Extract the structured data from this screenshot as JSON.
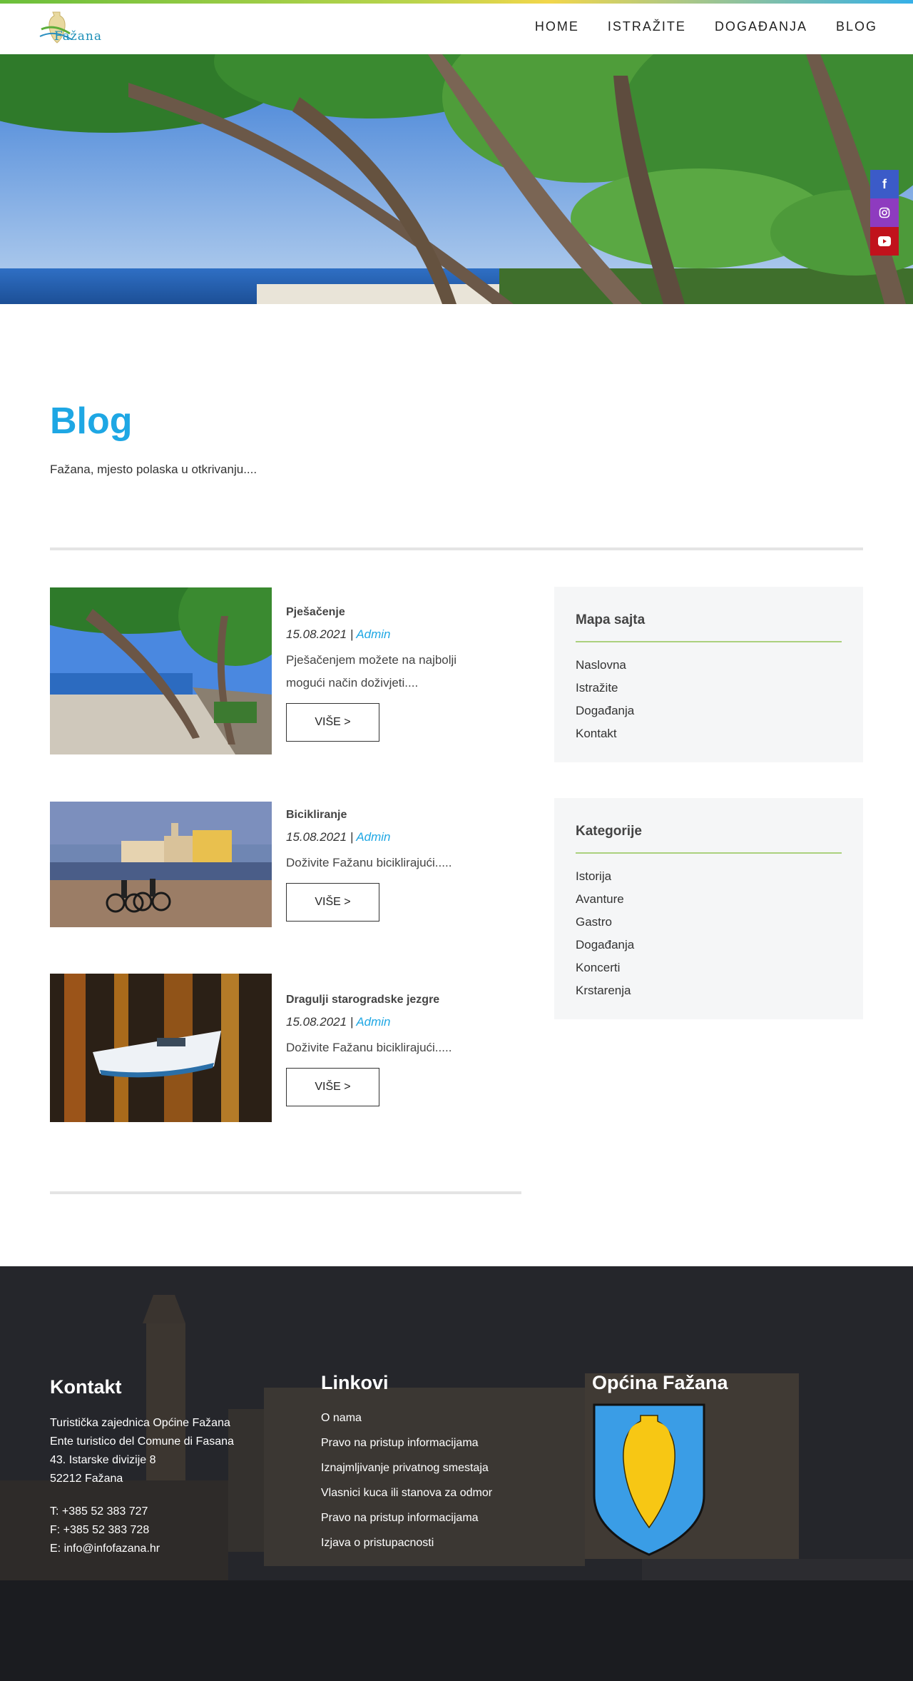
{
  "header": {
    "logo_text": "Fažana",
    "nav": [
      "HOME",
      "ISTRAŽITE",
      "DOGAĐANJA",
      "BLOG"
    ]
  },
  "social": [
    "facebook-icon",
    "instagram-icon",
    "youtube-icon"
  ],
  "main": {
    "title": "Blog",
    "subtitle": "Fažana, mjesto polaska u otkrivanju...."
  },
  "posts": [
    {
      "title": "Pješačenje",
      "date": "15.08.2021",
      "sep": " | ",
      "author": "Admin",
      "excerpt": "Pješačenjem možete na najbolji mogući način doživjeti....",
      "button": "VIŠE >"
    },
    {
      "title": "Bicikliranje",
      "date": "15.08.2021",
      "sep": " | ",
      "author": "Admin",
      "excerpt": "Doživite Fažanu biciklirajući.....",
      "button": "VIŠE >"
    },
    {
      "title": "Dragulji starogradske jezgre",
      "date": "15.08.2021",
      "sep": " | ",
      "author": "Admin",
      "excerpt": "Doživite Fažanu biciklirajući.....",
      "button": "VIŠE >"
    }
  ],
  "sidebar": {
    "sitemap": {
      "title": "Mapa sajta",
      "items": [
        "Naslovna",
        "Istražite",
        "Događanja",
        "Kontakt"
      ]
    },
    "categories": {
      "title": "Kategorije",
      "items": [
        "Istorija",
        "Avanture",
        "Gastro",
        "Događanja",
        "Koncerti",
        "Krstarenja"
      ]
    }
  },
  "footer": {
    "contact": {
      "title": "Kontakt",
      "lines": [
        "Turistička zajednica Općine Fažana",
        "Ente turistico del Comune di Fasana",
        "43. Istarske divizije 8",
        "52212 Fažana"
      ],
      "phone": "T: +385 52 383 727",
      "fax": "F: +385 52 383 728",
      "email": "E: info@infofazana.hr"
    },
    "links": {
      "title": "Linkovi",
      "items": [
        "O nama",
        "Pravo na pristup informacijama",
        "Iznajmljivanje privatnog smestaja",
        "Vlasnici kuca ili stanova za odmor",
        "Pravo na pristup informacijama",
        "Izjava o pristupacnosti"
      ]
    },
    "municipality": {
      "title": "Općina Fažana"
    }
  },
  "colors": {
    "accent": "#1ea7e4",
    "green": "#8cc24a",
    "footer_bg": "#1d1e22",
    "shield_blue": "#3a9de6",
    "amphora_yellow": "#f7c714"
  }
}
